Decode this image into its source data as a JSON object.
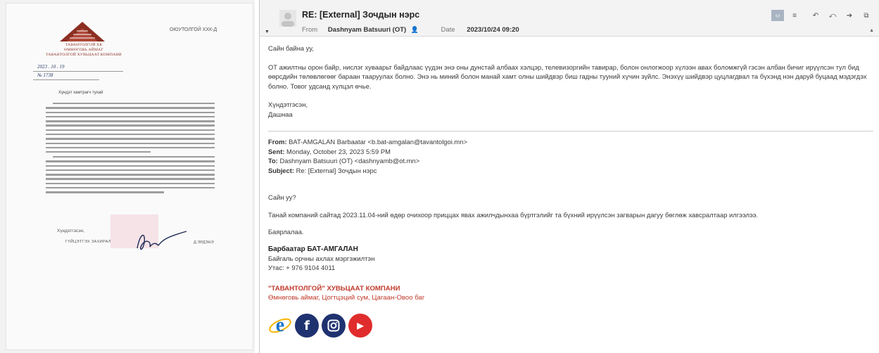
{
  "letter": {
    "org_lines": [
      "ТАВАНТОЛГОЙ ХК",
      "ӨМНӨГОВЬ АЙМАГ",
      "ТАВАНТОЛГОЙ ХУВЬЦААТ КОМПАНИ"
    ],
    "addressee": "ОЮУТОЛГОЙ ХХК-Д",
    "ref_date": "2023 . 10 . 19",
    "ref_no": "№ 1738",
    "salutation": "Хүндэт хамтрагч тухай",
    "signature_label": "Хүндэтгэсэн,",
    "signer_role": "ГҮЙЦЭТГЭХ ЗАХИРАЛ",
    "signer_name": "Д.ЭРДЭНЭ"
  },
  "email": {
    "subject": "RE: [External] Зочдын нэрс",
    "from_label": "From",
    "from_value": "Dashnyam Batsuuri (OT)",
    "date_label": "Date",
    "date_value": "2023/10/24 09:20",
    "toolbar_icons": [
      "view-toggle-icon",
      "menu-icon",
      "reply-icon",
      "reply-all-icon",
      "forward-icon",
      "popout-icon"
    ],
    "greeting": "Сайн байна уу,",
    "body": "ОТ ажилтны орон байр, нислэг хуваарьт байдлаас үүдэн энэ оны дунстай албаах хэлцэр, телевизоргийн тавирар, болон онлогжоор хүлээн авах боломжгүй гэсэн албан бичиг ирүүлсэн тул бид өөрсдийн төлөвлөгөөг бараан тааруулах болно. Энэ нь миний болон манай хамт олны шийдвэр биш гадны тууний хүчин зүйлс. Энэхүү шийдвэр цуцлагдвал та бүхэнд нэн даруй буцаад мэдэгдэх болно. Товог удсанд хүлцэл өчье.",
    "closing": "Хүндэтгэсэн,",
    "sender_short": "Дашнаа"
  },
  "quoted": {
    "from_label": "From:",
    "from_value": "BAT-AMGALAN Barbaatar <b.bat-amgalan@tavantolgoi.mn>",
    "sent_label": "Sent:",
    "sent_value": "Monday, October 23, 2023 5:59 PM",
    "to_label": "To:",
    "to_value": "Dashnyam Batsuuri (OT) <dashnyamb@ot.mn>",
    "subject_label": "Subject:",
    "subject_value": "Re: [External] Зочдын нэрс",
    "greeting": "Сайн уу?",
    "body": "Танай компаний сайтад 2023.11.04-ний өдөр очихоор приццах явах ажилчдынхаа бүртгэлийг та бүхний ирүүлсэн загварын дагуу бөглөж хавсралтаар илгээлээ.",
    "thanks": "Баярлалаа.",
    "sig_name": "Барбаатар БАТ-АМГАЛАН",
    "sig_title": "Байгаль орчны ахлах мэргэжилтэн",
    "sig_phone_label": "Утас:",
    "sig_phone": "+ 976 9104 4011",
    "company_name": "\"ТАВАНТОЛГОЙ\" ХУВЬЦААТ КОМПАНИ",
    "company_address": "Өмнөговь аймаг, Цогтцэций сум, Цагаан-Овоо баг"
  },
  "social": [
    {
      "name": "ie-icon",
      "glyph": "e",
      "color": "#1e74c9"
    },
    {
      "name": "facebook-icon",
      "glyph": "f",
      "color": "#1f3270"
    },
    {
      "name": "instagram-icon",
      "glyph": "",
      "color": "#1f3270"
    },
    {
      "name": "youtube-icon",
      "glyph": "▶",
      "color": "#e02c2c"
    }
  ]
}
